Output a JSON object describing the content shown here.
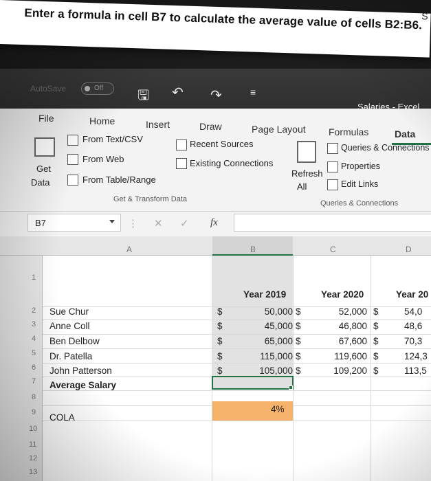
{
  "question": {
    "text": "Enter a formula in cell B7 to calculate the average value of cells B2:B6.",
    "corner": "S"
  },
  "titlebar": {
    "autosave_label": "AutoSave",
    "autosave_state": "Off",
    "file_name": "Salaries - Excel"
  },
  "ribbon": {
    "tabs": [
      "File",
      "Home",
      "Insert",
      "Draw",
      "Page Layout",
      "Formulas",
      "Data"
    ],
    "active_tab": "Data",
    "get_data": {
      "line1": "Get",
      "line2": "Data"
    },
    "get_transform": {
      "from_text_csv": "From Text/CSV",
      "from_web": "From Web",
      "from_table_range": "From Table/Range",
      "recent_sources": "Recent Sources",
      "existing_connections": "Existing Connections",
      "group_label": "Get & Transform Data"
    },
    "refresh": {
      "line1": "Refresh",
      "line2": "All"
    },
    "queries": {
      "queries_connections": "Queries & Connections",
      "properties": "Properties",
      "edit_links": "Edit Links",
      "group_label": "Queries & Connections"
    }
  },
  "formula_bar": {
    "name_box": "B7",
    "cancel_symbol": "✕",
    "enter_symbol": "✓",
    "fx_symbol": "fx",
    "formula": ""
  },
  "columns": [
    "A",
    "B",
    "C",
    "D"
  ],
  "rows": [
    "1",
    "2",
    "3",
    "4",
    "5",
    "6",
    "7",
    "8",
    "9",
    "10",
    "11",
    "12",
    "13"
  ],
  "headers": {
    "b": "Year 2019",
    "c": "Year 2020",
    "d": "Year 20"
  },
  "data_rows": [
    {
      "name": "Sue Chur",
      "b": "50,000",
      "c": "52,000",
      "d": "54,0"
    },
    {
      "name": "Anne Coll",
      "b": "45,000",
      "c": "46,800",
      "d": "48,6"
    },
    {
      "name": "Ben Delbow",
      "b": "65,000",
      "c": "67,600",
      "d": "70,3"
    },
    {
      "name": "Dr. Patella",
      "b": "115,000",
      "c": "119,600",
      "d": "124,3"
    },
    {
      "name": "John Patterson",
      "b": "105,000",
      "c": "109,200",
      "d": "113,5"
    }
  ],
  "currency_symbol": "$",
  "avg_label": "Average Salary",
  "rate": "4%",
  "cola_label": "COLA"
}
